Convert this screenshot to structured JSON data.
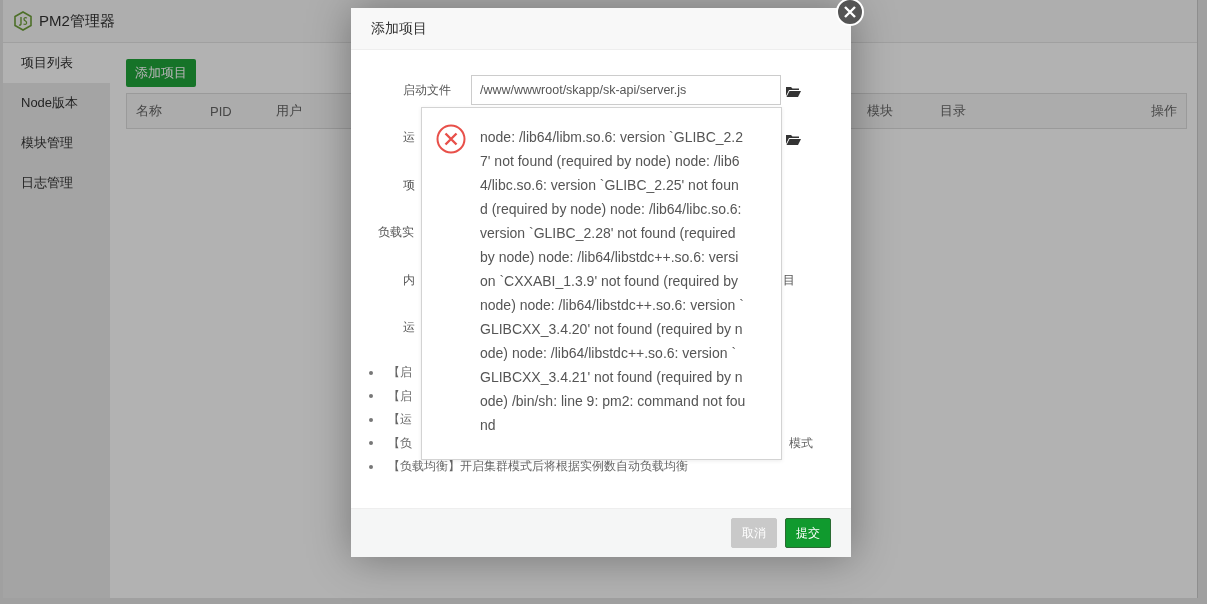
{
  "app": {
    "title": "PM2管理器",
    "sidebar": {
      "items": [
        {
          "label": "项目列表",
          "selected": true
        },
        {
          "label": "Node版本",
          "selected": false
        },
        {
          "label": "模块管理",
          "selected": false
        },
        {
          "label": "日志管理",
          "selected": false
        }
      ]
    },
    "add_button": "添加项目",
    "table": {
      "columns": [
        "名称",
        "PID",
        "用户",
        "模块",
        "目录",
        "操作"
      ]
    }
  },
  "dialog": {
    "title": "添加项目",
    "fields": [
      {
        "label": "启动文件",
        "value": "/www/wwwroot/skapp/sk-api/server.js",
        "browse": true
      },
      {
        "label": "运",
        "browse": true
      },
      {
        "label": "项"
      },
      {
        "label": "负载实"
      },
      {
        "label": "内",
        "suffix": "目"
      },
      {
        "label": "运"
      }
    ],
    "notes": [
      {
        "text": "【启"
      },
      {
        "text": "【启"
      },
      {
        "text": "【运"
      },
      {
        "text": "【负",
        "suffix": "模式"
      },
      {
        "text": "【负载均衡】开启集群模式后将根据实例数自动负载均衡"
      }
    ],
    "error": {
      "message": "node: /lib64/libm.so.6: version `GLIBC_2.27' not found (required by node) node: /lib64/libc.so.6: version `GLIBC_2.25' not found (required by node) node: /lib64/libc.so.6: version `GLIBC_2.28' not found (required by node) node: /lib64/libstdc++.so.6: version `CXXABI_1.3.9' not found (required by node) node: /lib64/libstdc++.so.6: version `GLIBCXX_3.4.20' not found (required by node) node: /lib64/libstdc++.so.6: version `GLIBCXX_3.4.21' not found (required by node) /bin/sh: line 9: pm2: command not found"
    },
    "buttons": [
      {
        "label": "取消",
        "kind": "cancel"
      },
      {
        "label": "提交",
        "kind": "submit"
      }
    ]
  }
}
